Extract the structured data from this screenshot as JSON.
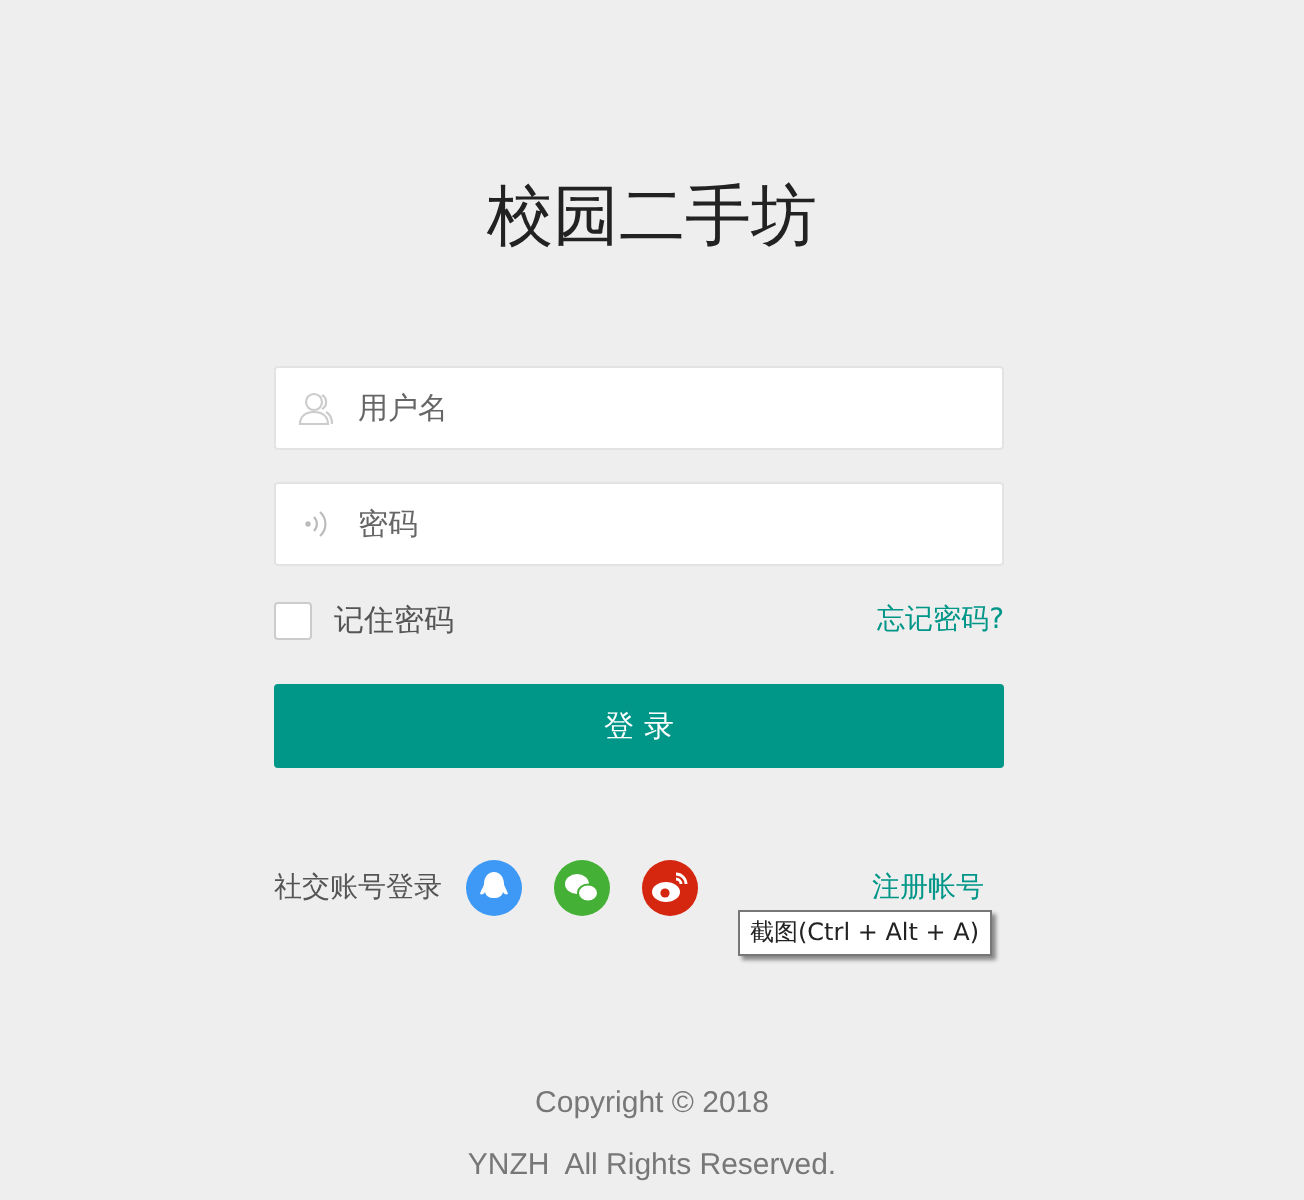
{
  "title": "校园二手坊",
  "fields": [
    {
      "kind": "user",
      "placeholder": "用户名"
    },
    {
      "kind": "password",
      "placeholder": "密码"
    }
  ],
  "remember": {
    "label": "记住密码",
    "checked": false
  },
  "forgot_link": "忘记密码?",
  "login_button": "登 录",
  "social": {
    "label": "社交账号登录",
    "services": [
      {
        "kind": "qq",
        "color": "#3d99f5"
      },
      {
        "kind": "wechat",
        "color": "#44b035"
      },
      {
        "kind": "weibo",
        "color": "#d5260f"
      }
    ]
  },
  "register_link": "注册帐号",
  "tooltip": "截图(Ctrl + Alt + A)",
  "footer": [
    "Copyright © 2018",
    "YNZH  All Rights Reserved."
  ]
}
